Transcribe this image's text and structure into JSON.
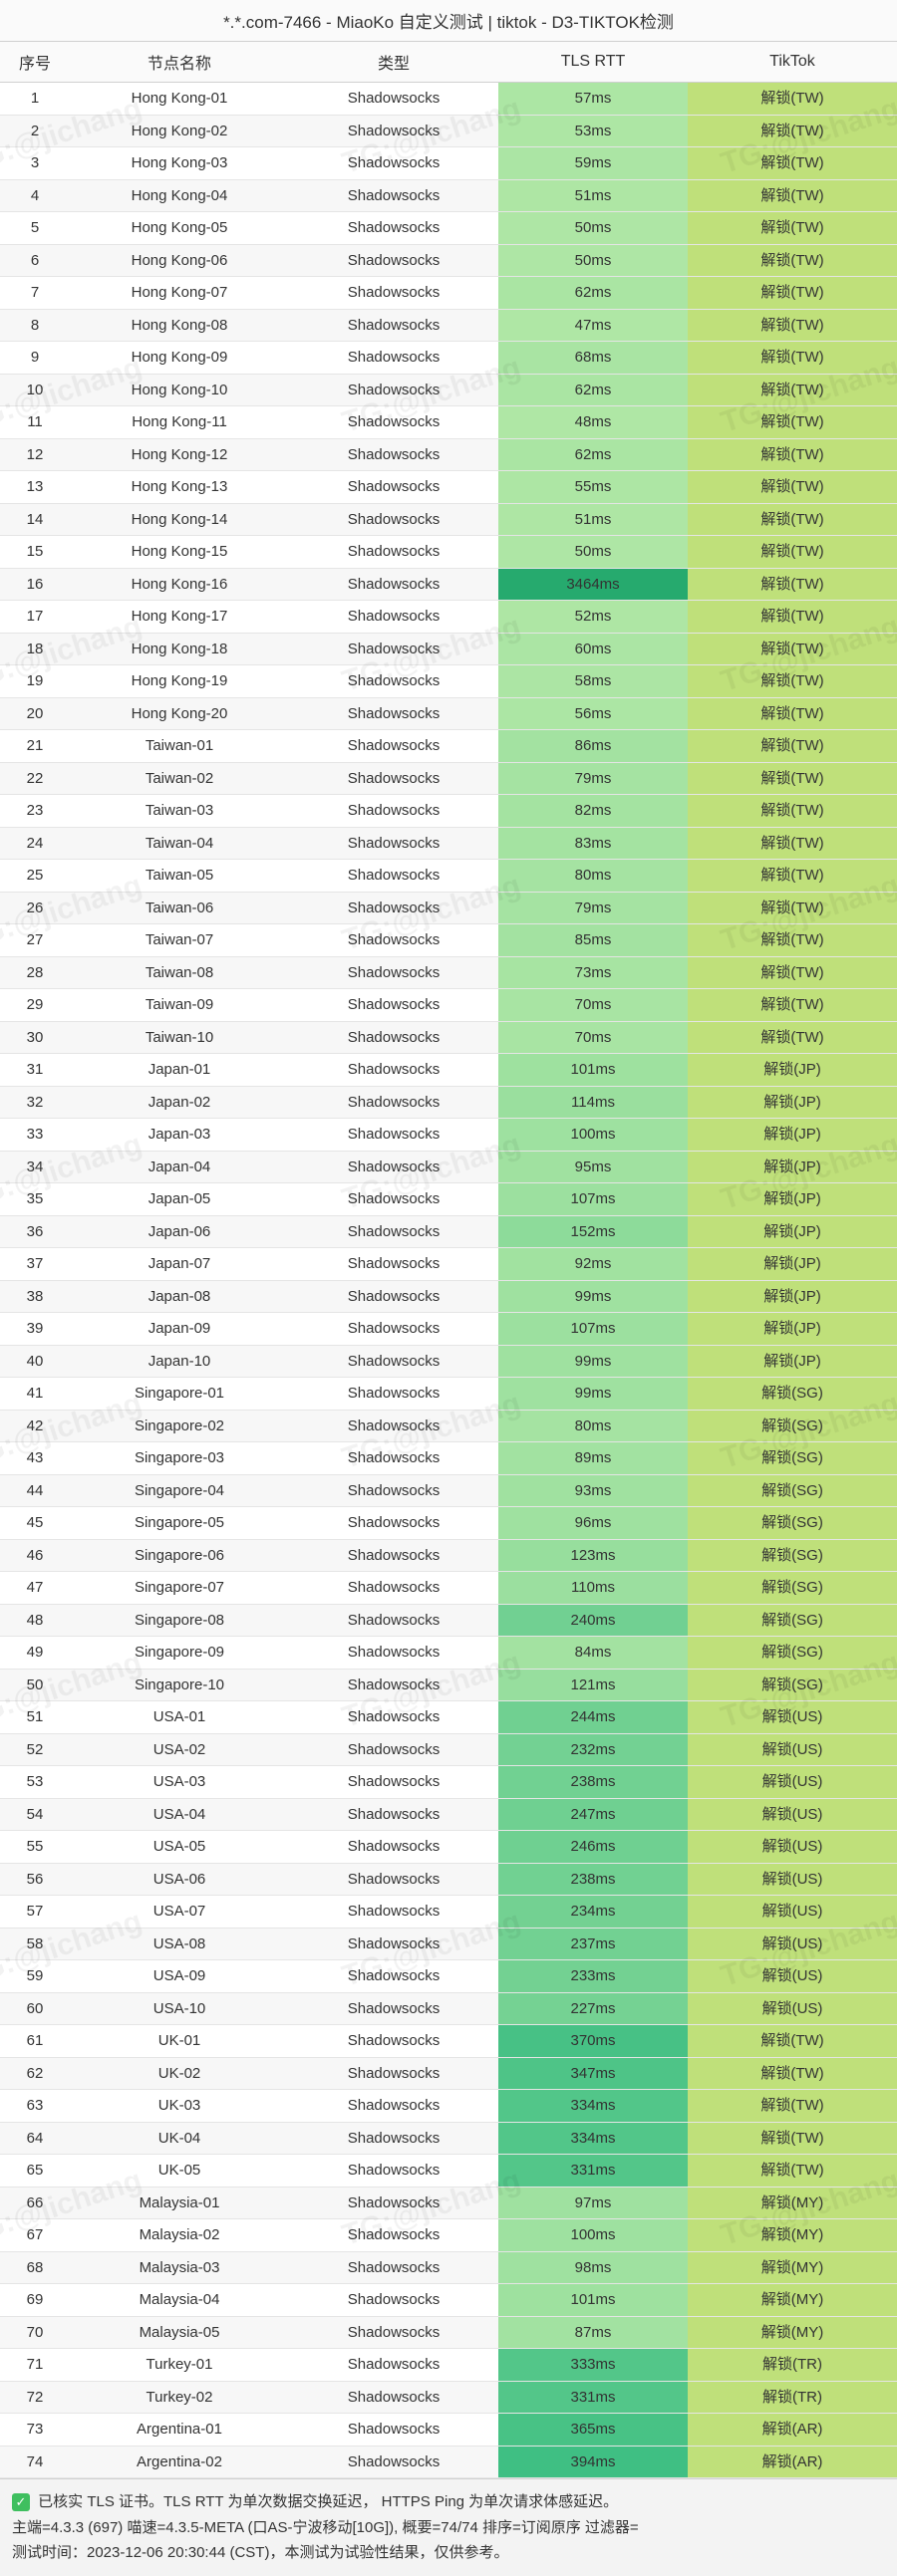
{
  "title": "*.*.com-7466 - MiaoKo 自定义测试 | tiktok - D3-TIKTOK检测",
  "headers": {
    "idx": "序号",
    "node": "节点名称",
    "type": "类型",
    "rtt": "TLS RTT",
    "tiktok": "TikTok"
  },
  "rtt_color_scale": {
    "min_ms": 47,
    "max_ms": 3464,
    "low_hex": "#a8e4a0",
    "mid_hex": "#5fcf8a",
    "high_hex": "#2fb673"
  },
  "tiktok_cell_hex": "#bfe07a",
  "rows": [
    {
      "idx": 1,
      "node": "Hong Kong-01",
      "type": "Shadowsocks",
      "rtt_ms": 57,
      "tiktok": "解锁(TW)"
    },
    {
      "idx": 2,
      "node": "Hong Kong-02",
      "type": "Shadowsocks",
      "rtt_ms": 53,
      "tiktok": "解锁(TW)"
    },
    {
      "idx": 3,
      "node": "Hong Kong-03",
      "type": "Shadowsocks",
      "rtt_ms": 59,
      "tiktok": "解锁(TW)"
    },
    {
      "idx": 4,
      "node": "Hong Kong-04",
      "type": "Shadowsocks",
      "rtt_ms": 51,
      "tiktok": "解锁(TW)"
    },
    {
      "idx": 5,
      "node": "Hong Kong-05",
      "type": "Shadowsocks",
      "rtt_ms": 50,
      "tiktok": "解锁(TW)"
    },
    {
      "idx": 6,
      "node": "Hong Kong-06",
      "type": "Shadowsocks",
      "rtt_ms": 50,
      "tiktok": "解锁(TW)"
    },
    {
      "idx": 7,
      "node": "Hong Kong-07",
      "type": "Shadowsocks",
      "rtt_ms": 62,
      "tiktok": "解锁(TW)"
    },
    {
      "idx": 8,
      "node": "Hong Kong-08",
      "type": "Shadowsocks",
      "rtt_ms": 47,
      "tiktok": "解锁(TW)"
    },
    {
      "idx": 9,
      "node": "Hong Kong-09",
      "type": "Shadowsocks",
      "rtt_ms": 68,
      "tiktok": "解锁(TW)"
    },
    {
      "idx": 10,
      "node": "Hong Kong-10",
      "type": "Shadowsocks",
      "rtt_ms": 62,
      "tiktok": "解锁(TW)"
    },
    {
      "idx": 11,
      "node": "Hong Kong-11",
      "type": "Shadowsocks",
      "rtt_ms": 48,
      "tiktok": "解锁(TW)"
    },
    {
      "idx": 12,
      "node": "Hong Kong-12",
      "type": "Shadowsocks",
      "rtt_ms": 62,
      "tiktok": "解锁(TW)"
    },
    {
      "idx": 13,
      "node": "Hong Kong-13",
      "type": "Shadowsocks",
      "rtt_ms": 55,
      "tiktok": "解锁(TW)"
    },
    {
      "idx": 14,
      "node": "Hong Kong-14",
      "type": "Shadowsocks",
      "rtt_ms": 51,
      "tiktok": "解锁(TW)"
    },
    {
      "idx": 15,
      "node": "Hong Kong-15",
      "type": "Shadowsocks",
      "rtt_ms": 50,
      "tiktok": "解锁(TW)"
    },
    {
      "idx": 16,
      "node": "Hong Kong-16",
      "type": "Shadowsocks",
      "rtt_ms": 3464,
      "tiktok": "解锁(TW)"
    },
    {
      "idx": 17,
      "node": "Hong Kong-17",
      "type": "Shadowsocks",
      "rtt_ms": 52,
      "tiktok": "解锁(TW)"
    },
    {
      "idx": 18,
      "node": "Hong Kong-18",
      "type": "Shadowsocks",
      "rtt_ms": 60,
      "tiktok": "解锁(TW)"
    },
    {
      "idx": 19,
      "node": "Hong Kong-19",
      "type": "Shadowsocks",
      "rtt_ms": 58,
      "tiktok": "解锁(TW)"
    },
    {
      "idx": 20,
      "node": "Hong Kong-20",
      "type": "Shadowsocks",
      "rtt_ms": 56,
      "tiktok": "解锁(TW)"
    },
    {
      "idx": 21,
      "node": "Taiwan-01",
      "type": "Shadowsocks",
      "rtt_ms": 86,
      "tiktok": "解锁(TW)"
    },
    {
      "idx": 22,
      "node": "Taiwan-02",
      "type": "Shadowsocks",
      "rtt_ms": 79,
      "tiktok": "解锁(TW)"
    },
    {
      "idx": 23,
      "node": "Taiwan-03",
      "type": "Shadowsocks",
      "rtt_ms": 82,
      "tiktok": "解锁(TW)"
    },
    {
      "idx": 24,
      "node": "Taiwan-04",
      "type": "Shadowsocks",
      "rtt_ms": 83,
      "tiktok": "解锁(TW)"
    },
    {
      "idx": 25,
      "node": "Taiwan-05",
      "type": "Shadowsocks",
      "rtt_ms": 80,
      "tiktok": "解锁(TW)"
    },
    {
      "idx": 26,
      "node": "Taiwan-06",
      "type": "Shadowsocks",
      "rtt_ms": 79,
      "tiktok": "解锁(TW)"
    },
    {
      "idx": 27,
      "node": "Taiwan-07",
      "type": "Shadowsocks",
      "rtt_ms": 85,
      "tiktok": "解锁(TW)"
    },
    {
      "idx": 28,
      "node": "Taiwan-08",
      "type": "Shadowsocks",
      "rtt_ms": 73,
      "tiktok": "解锁(TW)"
    },
    {
      "idx": 29,
      "node": "Taiwan-09",
      "type": "Shadowsocks",
      "rtt_ms": 70,
      "tiktok": "解锁(TW)"
    },
    {
      "idx": 30,
      "node": "Taiwan-10",
      "type": "Shadowsocks",
      "rtt_ms": 70,
      "tiktok": "解锁(TW)"
    },
    {
      "idx": 31,
      "node": "Japan-01",
      "type": "Shadowsocks",
      "rtt_ms": 101,
      "tiktok": "解锁(JP)"
    },
    {
      "idx": 32,
      "node": "Japan-02",
      "type": "Shadowsocks",
      "rtt_ms": 114,
      "tiktok": "解锁(JP)"
    },
    {
      "idx": 33,
      "node": "Japan-03",
      "type": "Shadowsocks",
      "rtt_ms": 100,
      "tiktok": "解锁(JP)"
    },
    {
      "idx": 34,
      "node": "Japan-04",
      "type": "Shadowsocks",
      "rtt_ms": 95,
      "tiktok": "解锁(JP)"
    },
    {
      "idx": 35,
      "node": "Japan-05",
      "type": "Shadowsocks",
      "rtt_ms": 107,
      "tiktok": "解锁(JP)"
    },
    {
      "idx": 36,
      "node": "Japan-06",
      "type": "Shadowsocks",
      "rtt_ms": 152,
      "tiktok": "解锁(JP)"
    },
    {
      "idx": 37,
      "node": "Japan-07",
      "type": "Shadowsocks",
      "rtt_ms": 92,
      "tiktok": "解锁(JP)"
    },
    {
      "idx": 38,
      "node": "Japan-08",
      "type": "Shadowsocks",
      "rtt_ms": 99,
      "tiktok": "解锁(JP)"
    },
    {
      "idx": 39,
      "node": "Japan-09",
      "type": "Shadowsocks",
      "rtt_ms": 107,
      "tiktok": "解锁(JP)"
    },
    {
      "idx": 40,
      "node": "Japan-10",
      "type": "Shadowsocks",
      "rtt_ms": 99,
      "tiktok": "解锁(JP)"
    },
    {
      "idx": 41,
      "node": "Singapore-01",
      "type": "Shadowsocks",
      "rtt_ms": 99,
      "tiktok": "解锁(SG)"
    },
    {
      "idx": 42,
      "node": "Singapore-02",
      "type": "Shadowsocks",
      "rtt_ms": 80,
      "tiktok": "解锁(SG)"
    },
    {
      "idx": 43,
      "node": "Singapore-03",
      "type": "Shadowsocks",
      "rtt_ms": 89,
      "tiktok": "解锁(SG)"
    },
    {
      "idx": 44,
      "node": "Singapore-04",
      "type": "Shadowsocks",
      "rtt_ms": 93,
      "tiktok": "解锁(SG)"
    },
    {
      "idx": 45,
      "node": "Singapore-05",
      "type": "Shadowsocks",
      "rtt_ms": 96,
      "tiktok": "解锁(SG)"
    },
    {
      "idx": 46,
      "node": "Singapore-06",
      "type": "Shadowsocks",
      "rtt_ms": 123,
      "tiktok": "解锁(SG)"
    },
    {
      "idx": 47,
      "node": "Singapore-07",
      "type": "Shadowsocks",
      "rtt_ms": 110,
      "tiktok": "解锁(SG)"
    },
    {
      "idx": 48,
      "node": "Singapore-08",
      "type": "Shadowsocks",
      "rtt_ms": 240,
      "tiktok": "解锁(SG)"
    },
    {
      "idx": 49,
      "node": "Singapore-09",
      "type": "Shadowsocks",
      "rtt_ms": 84,
      "tiktok": "解锁(SG)"
    },
    {
      "idx": 50,
      "node": "Singapore-10",
      "type": "Shadowsocks",
      "rtt_ms": 121,
      "tiktok": "解锁(SG)"
    },
    {
      "idx": 51,
      "node": "USA-01",
      "type": "Shadowsocks",
      "rtt_ms": 244,
      "tiktok": "解锁(US)"
    },
    {
      "idx": 52,
      "node": "USA-02",
      "type": "Shadowsocks",
      "rtt_ms": 232,
      "tiktok": "解锁(US)"
    },
    {
      "idx": 53,
      "node": "USA-03",
      "type": "Shadowsocks",
      "rtt_ms": 238,
      "tiktok": "解锁(US)"
    },
    {
      "idx": 54,
      "node": "USA-04",
      "type": "Shadowsocks",
      "rtt_ms": 247,
      "tiktok": "解锁(US)"
    },
    {
      "idx": 55,
      "node": "USA-05",
      "type": "Shadowsocks",
      "rtt_ms": 246,
      "tiktok": "解锁(US)"
    },
    {
      "idx": 56,
      "node": "USA-06",
      "type": "Shadowsocks",
      "rtt_ms": 238,
      "tiktok": "解锁(US)"
    },
    {
      "idx": 57,
      "node": "USA-07",
      "type": "Shadowsocks",
      "rtt_ms": 234,
      "tiktok": "解锁(US)"
    },
    {
      "idx": 58,
      "node": "USA-08",
      "type": "Shadowsocks",
      "rtt_ms": 237,
      "tiktok": "解锁(US)"
    },
    {
      "idx": 59,
      "node": "USA-09",
      "type": "Shadowsocks",
      "rtt_ms": 233,
      "tiktok": "解锁(US)"
    },
    {
      "idx": 60,
      "node": "USA-10",
      "type": "Shadowsocks",
      "rtt_ms": 227,
      "tiktok": "解锁(US)"
    },
    {
      "idx": 61,
      "node": "UK-01",
      "type": "Shadowsocks",
      "rtt_ms": 370,
      "tiktok": "解锁(TW)"
    },
    {
      "idx": 62,
      "node": "UK-02",
      "type": "Shadowsocks",
      "rtt_ms": 347,
      "tiktok": "解锁(TW)"
    },
    {
      "idx": 63,
      "node": "UK-03",
      "type": "Shadowsocks",
      "rtt_ms": 334,
      "tiktok": "解锁(TW)"
    },
    {
      "idx": 64,
      "node": "UK-04",
      "type": "Shadowsocks",
      "rtt_ms": 334,
      "tiktok": "解锁(TW)"
    },
    {
      "idx": 65,
      "node": "UK-05",
      "type": "Shadowsocks",
      "rtt_ms": 331,
      "tiktok": "解锁(TW)"
    },
    {
      "idx": 66,
      "node": "Malaysia-01",
      "type": "Shadowsocks",
      "rtt_ms": 97,
      "tiktok": "解锁(MY)"
    },
    {
      "idx": 67,
      "node": "Malaysia-02",
      "type": "Shadowsocks",
      "rtt_ms": 100,
      "tiktok": "解锁(MY)"
    },
    {
      "idx": 68,
      "node": "Malaysia-03",
      "type": "Shadowsocks",
      "rtt_ms": 98,
      "tiktok": "解锁(MY)"
    },
    {
      "idx": 69,
      "node": "Malaysia-04",
      "type": "Shadowsocks",
      "rtt_ms": 101,
      "tiktok": "解锁(MY)"
    },
    {
      "idx": 70,
      "node": "Malaysia-05",
      "type": "Shadowsocks",
      "rtt_ms": 87,
      "tiktok": "解锁(MY)"
    },
    {
      "idx": 71,
      "node": "Turkey-01",
      "type": "Shadowsocks",
      "rtt_ms": 333,
      "tiktok": "解锁(TR)"
    },
    {
      "idx": 72,
      "node": "Turkey-02",
      "type": "Shadowsocks",
      "rtt_ms": 331,
      "tiktok": "解锁(TR)"
    },
    {
      "idx": 73,
      "node": "Argentina-01",
      "type": "Shadowsocks",
      "rtt_ms": 365,
      "tiktok": "解锁(AR)"
    },
    {
      "idx": 74,
      "node": "Argentina-02",
      "type": "Shadowsocks",
      "rtt_ms": 394,
      "tiktok": "解锁(AR)"
    }
  ],
  "footer": {
    "line1": "已核实 TLS 证书。TLS RTT 为单次数据交换延迟， HTTPS Ping 为单次请求体感延迟。",
    "line2": "主端=4.3.3 (697) 喵速=4.3.5-META (口AS-宁波移动[10G]), 概要=74/74 排序=订阅原序 过滤器=",
    "line3": "测试时间：2023-12-06 20:30:44 (CST)，本测试为试验性结果，仅供参考。"
  },
  "watermark": "TG:@jichang"
}
